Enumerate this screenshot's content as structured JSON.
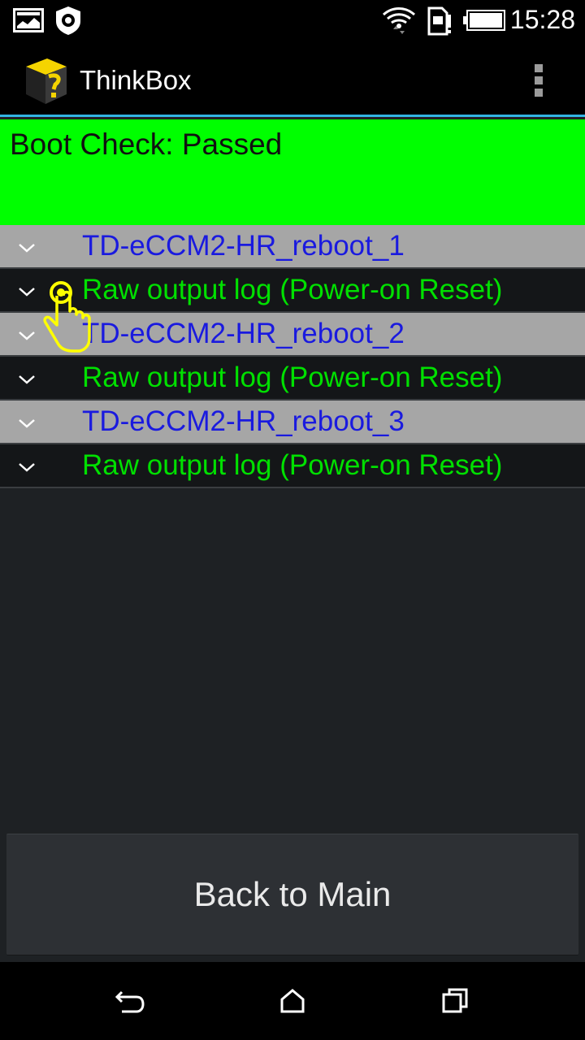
{
  "status_bar": {
    "time": "15:28",
    "icons": [
      "gallery-icon",
      "settings-notification-icon",
      "wifi-icon",
      "sim-card-icon",
      "battery-icon"
    ]
  },
  "action_bar": {
    "title": "ThinkBox",
    "logo_icon": "thinkbox-logo-icon",
    "menu_icon": "overflow-menu-icon"
  },
  "banner": {
    "text": "Boot Check: Passed",
    "color": "#00ff00"
  },
  "list": {
    "items": [
      {
        "type": "group",
        "label": "TD-eCCM2-HR_reboot_1"
      },
      {
        "type": "child",
        "label": "Raw output log (Power-on Reset)"
      },
      {
        "type": "group",
        "label": "TD-eCCM2-HR_reboot_2"
      },
      {
        "type": "child",
        "label": "Raw output log (Power-on Reset)"
      },
      {
        "type": "group",
        "label": "TD-eCCM2-HR_reboot_3"
      },
      {
        "type": "child",
        "label": "Raw output log (Power-on Reset)"
      }
    ]
  },
  "button": {
    "label": "Back to Main"
  },
  "nav_bar": {
    "icons": [
      "back-icon",
      "home-icon",
      "recents-icon"
    ]
  },
  "colors": {
    "group_text": "#1a1adf",
    "child_text": "#00e000",
    "accent": "#33b5e5"
  }
}
